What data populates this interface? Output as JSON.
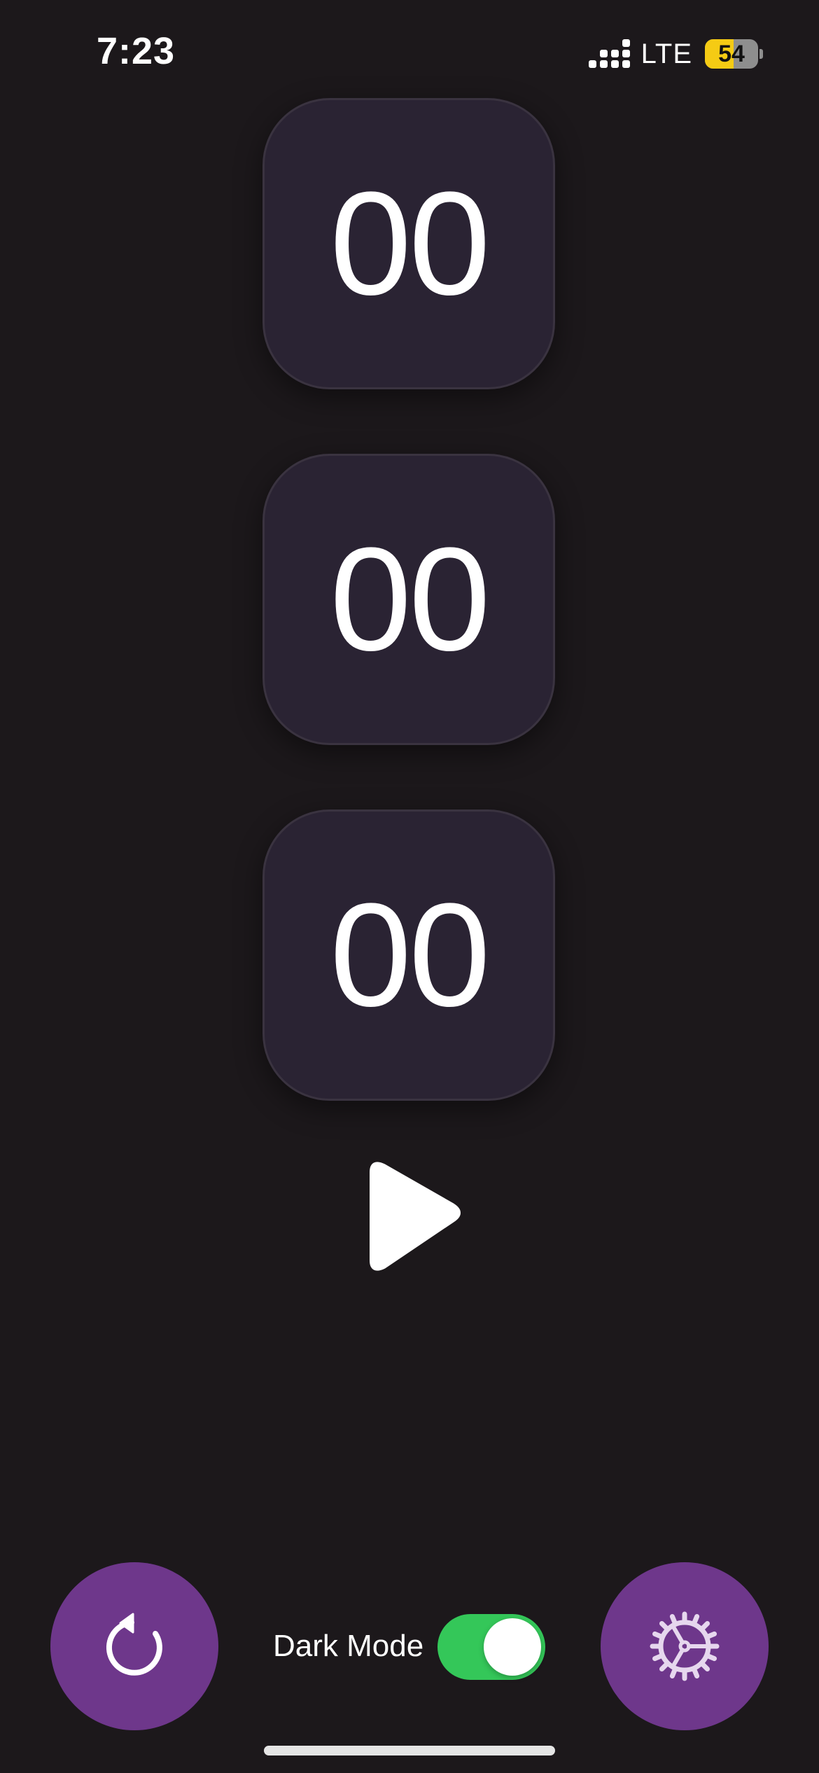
{
  "status_bar": {
    "time": "7:23",
    "network": "LTE",
    "battery_level": "54",
    "battery_fraction": 0.54,
    "battery_color": "#f5cb14"
  },
  "timer": {
    "hours": "00",
    "minutes": "00",
    "seconds": "00"
  },
  "controls": {
    "play_icon": "play-icon",
    "reset_icon": "reset-icon",
    "settings_icon": "gear-icon",
    "dark_mode_label": "Dark Mode",
    "dark_mode_on": true
  },
  "colors": {
    "background": "#1c181b",
    "card": "#2a2333",
    "accent": "#6e378b",
    "toggle_on": "#34c759"
  }
}
